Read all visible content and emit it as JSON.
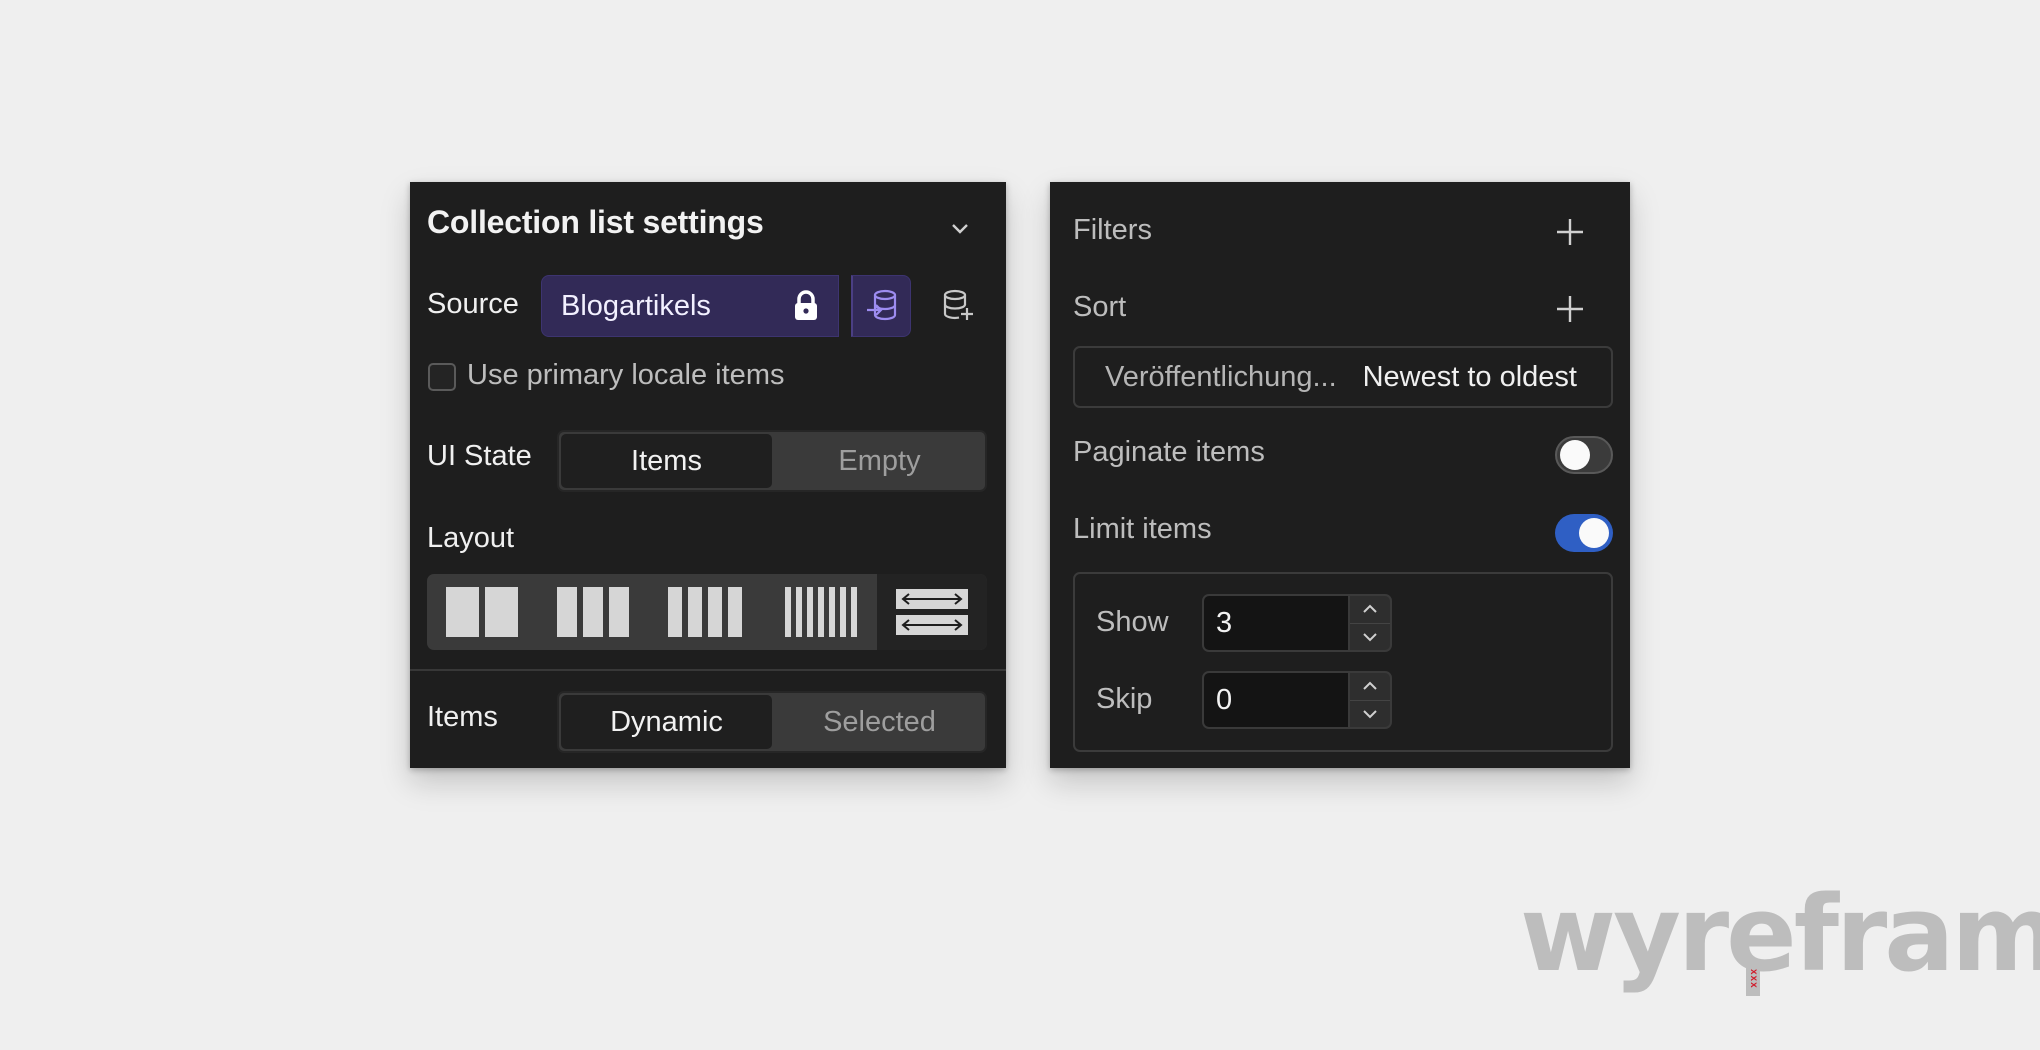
{
  "collection_settings": {
    "title": "Collection list settings",
    "source": {
      "label": "Source",
      "value": "Blogartikels"
    },
    "primary_locale": {
      "label": "Use primary locale items",
      "checked": false
    },
    "ui_state": {
      "label": "UI State",
      "options": [
        "Items",
        "Empty"
      ],
      "selected": "Items"
    },
    "layout": {
      "label": "Layout",
      "options": [
        "2-columns",
        "3-columns",
        "4-columns",
        "6-columns",
        "rows"
      ],
      "selected": "rows"
    },
    "items": {
      "label": "Items",
      "options": [
        "Dynamic",
        "Selected"
      ],
      "selected": "Dynamic"
    }
  },
  "query_settings": {
    "filters": {
      "label": "Filters"
    },
    "sort": {
      "label": "Sort",
      "field": "Veröffentlichung...",
      "order": "Newest to oldest"
    },
    "paginate": {
      "label": "Paginate items",
      "enabled": false
    },
    "limit": {
      "label": "Limit items",
      "enabled": true,
      "show": {
        "label": "Show",
        "value": "3"
      },
      "skip": {
        "label": "Skip",
        "value": "0"
      }
    }
  },
  "watermark": {
    "text": "wyreframe",
    "mark": "xxx"
  },
  "colors": {
    "panel_bg": "#1e1e1e",
    "source_accent": "#322a57",
    "source_icon": "#9d8cf0",
    "toggle_on": "#2f5fc4",
    "watermark": "#bdbdbd",
    "watermark_mark": "#d11a2a"
  }
}
